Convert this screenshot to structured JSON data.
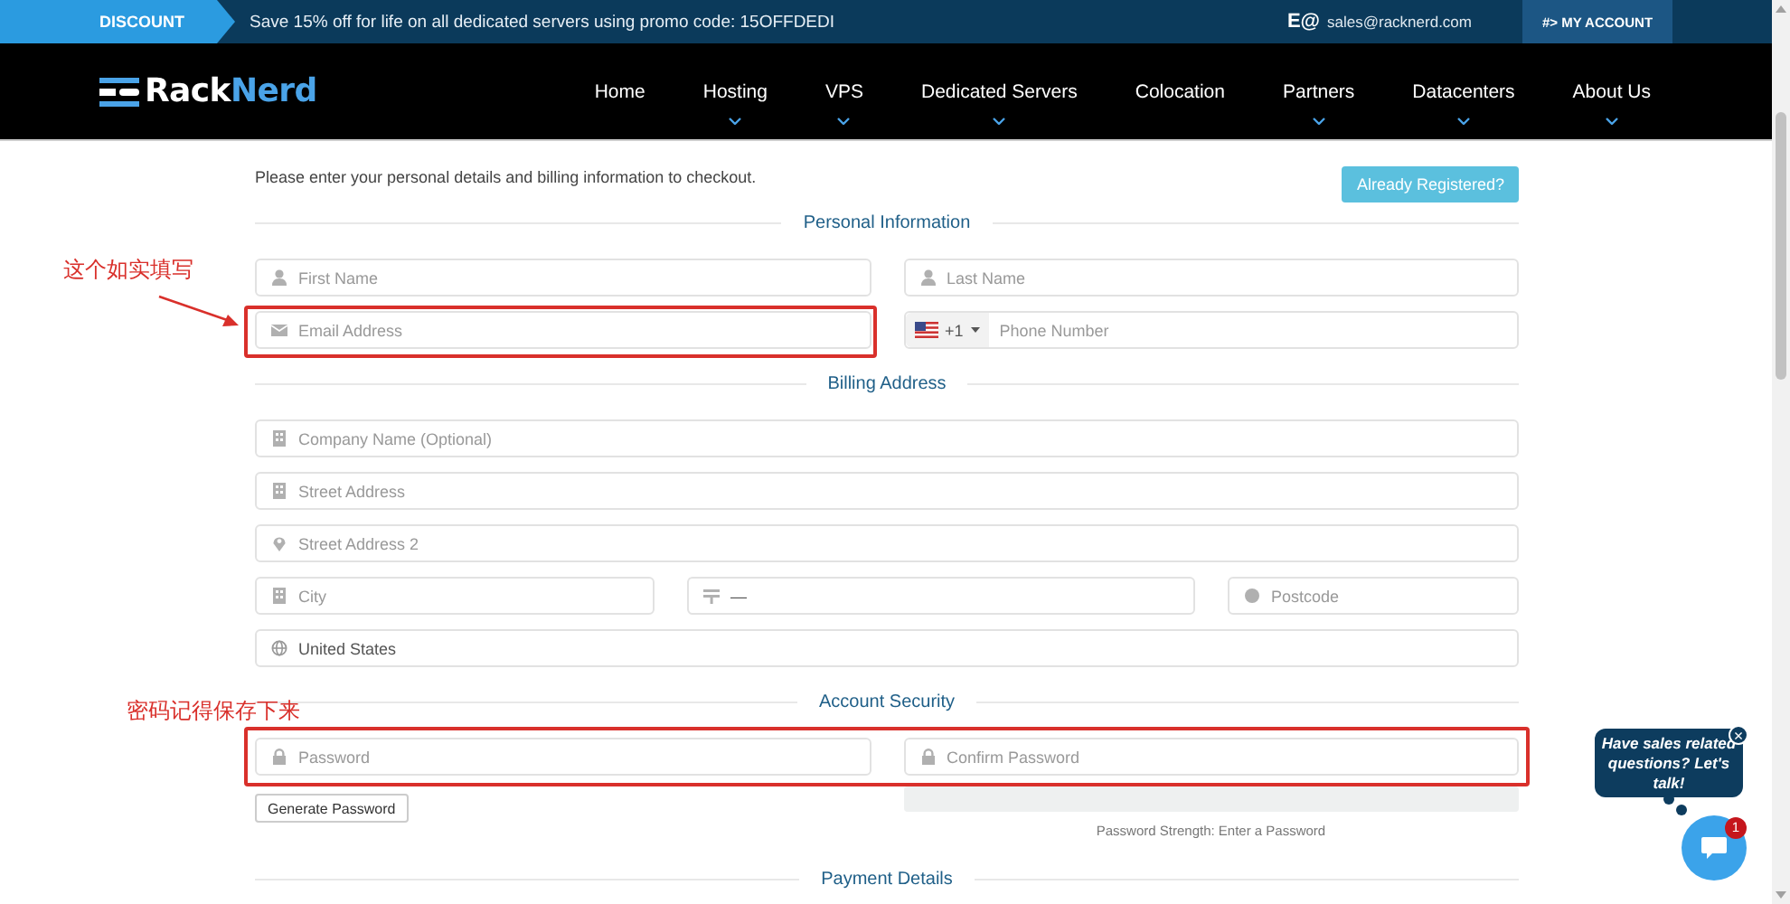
{
  "top_bar": {
    "badge": "DISCOUNT",
    "promo": "Save 15% off for life on all dedicated servers using promo code: 15OFFDEDI",
    "contact_glyph": "E@",
    "email": "sales@racknerd.com",
    "account_button": "#> MY ACCOUNT"
  },
  "nav": {
    "logo": [
      "Rack",
      "Nerd"
    ],
    "items": [
      {
        "label": "Home",
        "has_dropdown": false
      },
      {
        "label": "Hosting",
        "has_dropdown": true
      },
      {
        "label": "VPS",
        "has_dropdown": true
      },
      {
        "label": "Dedicated Servers",
        "has_dropdown": true
      },
      {
        "label": "Colocation",
        "has_dropdown": false
      },
      {
        "label": "Partners",
        "has_dropdown": true
      },
      {
        "label": "Datacenters",
        "has_dropdown": true
      },
      {
        "label": "About Us",
        "has_dropdown": true
      }
    ]
  },
  "form": {
    "intro": "Please enter your personal details and billing information to checkout.",
    "already_registered": "Already Registered?",
    "sections": [
      {
        "title": "Personal Information",
        "rows": [
          {
            "highlighted": false,
            "fields": [
              {
                "kind": "text",
                "placeholder": "First Name",
                "highlighted": false
              },
              {
                "kind": "text",
                "placeholder": "Last Name",
                "highlighted": false
              }
            ]
          },
          {
            "highlighted": false,
            "fields": [
              {
                "kind": "text",
                "placeholder": "Email Address",
                "highlighted": true,
                "note": "这个如实填写"
              },
              {
                "kind": "phone",
                "dial_code": "+1",
                "placeholder": "Phone Number",
                "highlighted": false
              }
            ]
          }
        ]
      },
      {
        "title": "Billing Address",
        "rows": [
          {
            "highlighted": false,
            "fields": [
              {
                "kind": "text",
                "placeholder": "Company Name (Optional)",
                "highlighted": false
              }
            ]
          },
          {
            "highlighted": false,
            "fields": [
              {
                "kind": "text",
                "placeholder": "Street Address",
                "highlighted": false
              }
            ]
          },
          {
            "highlighted": false,
            "fields": [
              {
                "kind": "text",
                "placeholder": "Street Address 2",
                "highlighted": false
              }
            ]
          },
          {
            "highlighted": false,
            "fields": [
              {
                "kind": "text",
                "placeholder": "City",
                "highlighted": false
              },
              {
                "kind": "select",
                "value": "—",
                "highlighted": false
              },
              {
                "kind": "text",
                "placeholder": "Postcode",
                "highlighted": false
              }
            ]
          },
          {
            "highlighted": false,
            "fields": [
              {
                "kind": "select",
                "value": "United States",
                "highlighted": false
              }
            ]
          }
        ]
      },
      {
        "title": "Account Security",
        "rows": [
          {
            "highlighted": true,
            "note": "密码记得保存下来",
            "fields": [
              {
                "kind": "text",
                "placeholder": "Password",
                "highlighted": false
              },
              {
                "kind": "text",
                "placeholder": "Confirm Password",
                "highlighted": false
              }
            ]
          }
        ],
        "generate_button": "Generate Password",
        "strength": {
          "label": "Password Strength: Enter a Password",
          "level": 0
        }
      },
      {
        "title": "Payment Details"
      }
    ]
  },
  "chat": {
    "message": "Have sales related questions? Let's talk!",
    "close": "×",
    "badge": "1"
  }
}
